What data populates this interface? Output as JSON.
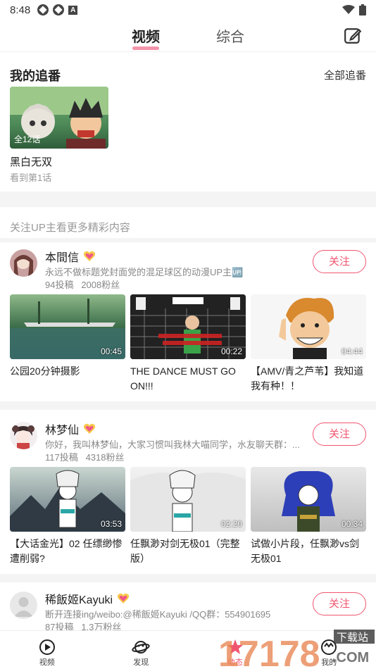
{
  "status_bar": {
    "time": "8:48"
  },
  "tabs": [
    {
      "label": "视频",
      "active": true
    },
    {
      "label": "综合",
      "active": false
    }
  ],
  "following": {
    "title": "我的追番",
    "all_label": "全部追番",
    "item": {
      "episodes": "全12话",
      "title": "黑白无双",
      "progress": "看到第1话"
    }
  },
  "hint": "关注UP主看更多精彩内容",
  "follow_label": "关注",
  "ups": [
    {
      "name": "本間信",
      "desc": "永远不做标题党封面党的混足球区的动漫UP主🆙",
      "posts": "94投稿",
      "fans": "2008粉丝",
      "videos": [
        {
          "duration": "00:45",
          "title": "公园20分钟摄影"
        },
        {
          "duration": "00:22",
          "title": "THE DANCE MUST GO ON!!!"
        },
        {
          "duration": "04:44",
          "title": "【AMV/青之芦苇】我知道我有种！！"
        }
      ]
    },
    {
      "name": "林梦仙",
      "desc": "你好，我叫林梦仙，大家习惯叫我林大喵同学，水友聊天群：...",
      "posts": "117投稿",
      "fans": "4318粉丝",
      "videos": [
        {
          "duration": "03:53",
          "title": "【大话金光】02 任缥缈惨遭削弱?"
        },
        {
          "duration": "02:20",
          "title": "任飘渺对剑无极01（完整版）"
        },
        {
          "duration": "00:34",
          "title": "试做小片段，任飘渺vs剑无极01"
        }
      ]
    },
    {
      "name": "稀飯姬Kayuki",
      "desc": "断开连接ing/weibo:@稀飯姬Kayuki /QQ群：554901695",
      "posts": "87投稿",
      "fans": "1.3万粉丝"
    }
  ],
  "bottom_nav": [
    {
      "label": "视频",
      "icon": "play-circle-icon",
      "active": false
    },
    {
      "label": "发现",
      "icon": "planet-icon",
      "active": false
    },
    {
      "label": "动态",
      "icon": "star-icon",
      "active": true
    },
    {
      "label": "我的",
      "icon": "face-icon",
      "active": false
    }
  ],
  "watermark": {
    "text": "17178",
    "sub": "下载站",
    "domain": ".COM"
  },
  "colors": {
    "accent": "#f05670",
    "text": "#222222",
    "muted": "#888888"
  }
}
